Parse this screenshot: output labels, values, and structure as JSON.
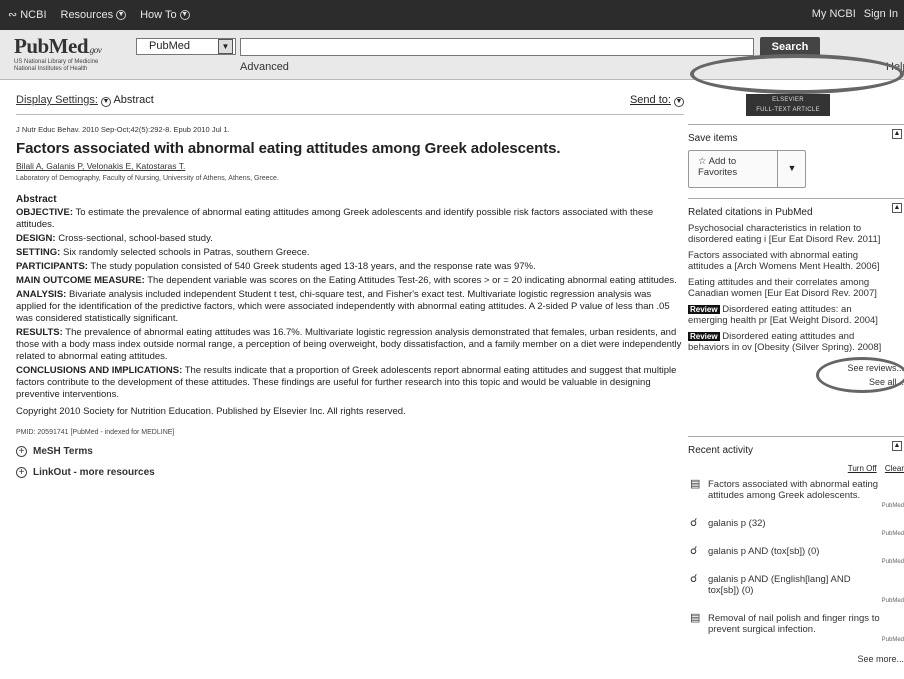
{
  "topbar": {
    "ncbi": "NCBI",
    "resources": "Resources",
    "howto": "How To",
    "myncbi": "My NCBI",
    "signin": "Sign In"
  },
  "header": {
    "brand": "PubMed",
    "brand_gov": ".gov",
    "sub1": "US National Library of Medicine",
    "sub2": "National Institutes of Health",
    "db": "PubMed",
    "search_value": "",
    "search_button": "Search",
    "advanced": "Advanced",
    "help": "Help"
  },
  "display": {
    "label": "Display Settings:",
    "value": "Abstract",
    "sendto": "Send to:"
  },
  "article": {
    "citation": "J Nutr Educ Behav. 2010 Sep-Oct;42(5):292-8. Epub 2010 Jul 1.",
    "title": "Factors associated with abnormal eating attitudes among Greek adolescents.",
    "authors": "Bilali A, Galanis P, Velonakis E, Katostaras T.",
    "affiliation": "Laboratory of Demography, Faculty of Nursing, University of Athens, Athens, Greece.",
    "abstract_heading": "Abstract",
    "sections": [
      {
        "label": "OBJECTIVE:",
        "text": "To estimate the prevalence of abnormal eating attitudes among Greek adolescents and identify possible risk factors associated with these attitudes."
      },
      {
        "label": "DESIGN:",
        "text": "Cross-sectional, school-based study."
      },
      {
        "label": "SETTING:",
        "text": "Six randomly selected schools in Patras, southern Greece."
      },
      {
        "label": "PARTICIPANTS:",
        "text": "The study population consisted of 540 Greek students aged 13-18 years, and the response rate was 97%."
      },
      {
        "label": "MAIN OUTCOME MEASURE:",
        "text": "The dependent variable was scores on the Eating Attitudes Test-26, with scores > or = 20 indicating abnormal eating attitudes."
      },
      {
        "label": "ANALYSIS:",
        "text": "Bivariate analysis included independent Student t test, chi-square test, and Fisher's exact test. Multivariate logistic regression analysis was applied for the identification of the predictive factors, which were associated independently with abnormal eating attitudes. A 2-sided P value of less than .05 was considered statistically significant."
      },
      {
        "label": "RESULTS:",
        "text": "The prevalence of abnormal eating attitudes was 16.7%. Multivariate logistic regression analysis demonstrated that females, urban residents, and those with a body mass index outside normal range, a perception of being overweight, body dissatisfaction, and a family member on a diet were independently related to abnormal eating attitudes."
      },
      {
        "label": "CONCLUSIONS AND IMPLICATIONS:",
        "text": "The results indicate that a proportion of Greek adolescents report abnormal eating attitudes and suggest that multiple factors contribute to the development of these attitudes. These findings are useful for further research into this topic and would be valuable in designing preventive interventions."
      }
    ],
    "copyright": "Copyright 2010 Society for Nutrition Education. Published by Elsevier Inc. All rights reserved.",
    "pmid": "PMID: 20591741 [PubMed - indexed for MEDLINE]",
    "mesh": "MeSH Terms",
    "linkout": "LinkOut - more resources"
  },
  "sidebar": {
    "elsevier_1": "ELSEVIER",
    "elsevier_2": "FULL-TEXT ARTICLE",
    "save_title": "Save items",
    "add_fav_1": "Add to",
    "add_fav_2": "Favorites",
    "related_title": "Related citations in PubMed",
    "related": [
      {
        "badge": "",
        "l1": "Psychosocial characteristics in relation to",
        "l2": "disordered eating i [Eur Eat Disord Rev. 2011]"
      },
      {
        "badge": "",
        "l1": "Factors associated with abnormal eating",
        "l2": "attitudes a [Arch Womens Ment Health. 2006]"
      },
      {
        "badge": "",
        "l1": "Eating attitudes and their correlates among",
        "l2": "Canadian women [Eur Eat Disord Rev. 2007]"
      },
      {
        "badge": "Review",
        "l1": "Disordered eating attitudes: an",
        "l2": "emerging health pr [Eat Weight Disord. 2004]"
      },
      {
        "badge": "Review",
        "l1": "Disordered eating attitudes and",
        "l2": "behaviors in ov [Obesity (Silver Spring). 2008]"
      }
    ],
    "see_reviews": "See reviews...",
    "see_all": "See all...",
    "recent_title": "Recent activity",
    "turn_off": "Turn Off",
    "clear": "Clear",
    "recent": [
      {
        "icon": "doc",
        "l1": "Factors associated with abnormal eating",
        "l2": "attitudes among Greek adolescents.",
        "src": "PubMed"
      },
      {
        "icon": "search",
        "l1": "galanis p (32)",
        "l2": "",
        "src": "PubMed"
      },
      {
        "icon": "search",
        "l1": "galanis p AND (tox[sb]) (0)",
        "l2": "",
        "src": "PubMed"
      },
      {
        "icon": "search",
        "l1": "galanis p AND (English[lang] AND",
        "l2": "tox[sb]) (0)",
        "src": "PubMed"
      },
      {
        "icon": "doc",
        "l1": "Removal of nail polish and finger rings to",
        "l2": "prevent surgical infection.",
        "src": "PubMed"
      }
    ],
    "see_more": "See more..."
  }
}
